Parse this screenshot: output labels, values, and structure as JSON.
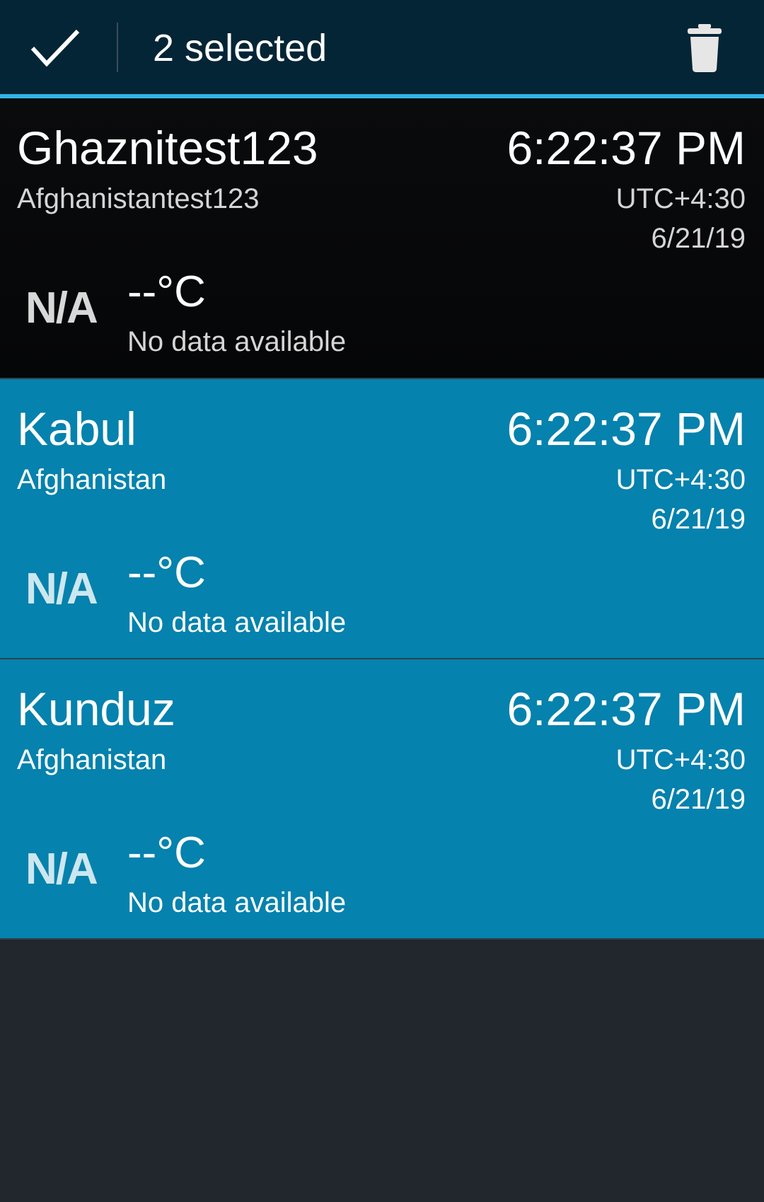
{
  "action_bar": {
    "done_icon": "checkmark-icon",
    "selected_text": "2 selected",
    "delete_icon": "trash-icon"
  },
  "colors": {
    "action_bar_bg": "#042535",
    "accent": "#33b5e5",
    "selected_row_bg": "#0582ad",
    "unselected_row_bg": "#08090b",
    "empty_area_bg": "#22262d"
  },
  "cities": [
    {
      "city": "Ghaznitest123",
      "country": "Afghanistantest123",
      "time": "6:22:37 PM",
      "utc": "UTC+4:30",
      "date": "6/21/19",
      "weather_icon": "N/A",
      "temperature": "--°C",
      "condition": "No data available",
      "selected": false
    },
    {
      "city": "Kabul",
      "country": "Afghanistan",
      "time": "6:22:37 PM",
      "utc": "UTC+4:30",
      "date": "6/21/19",
      "weather_icon": "N/A",
      "temperature": "--°C",
      "condition": "No data available",
      "selected": true
    },
    {
      "city": "Kunduz",
      "country": "Afghanistan",
      "time": "6:22:37 PM",
      "utc": "UTC+4:30",
      "date": "6/21/19",
      "weather_icon": "N/A",
      "temperature": "--°C",
      "condition": "No data available",
      "selected": true
    }
  ]
}
